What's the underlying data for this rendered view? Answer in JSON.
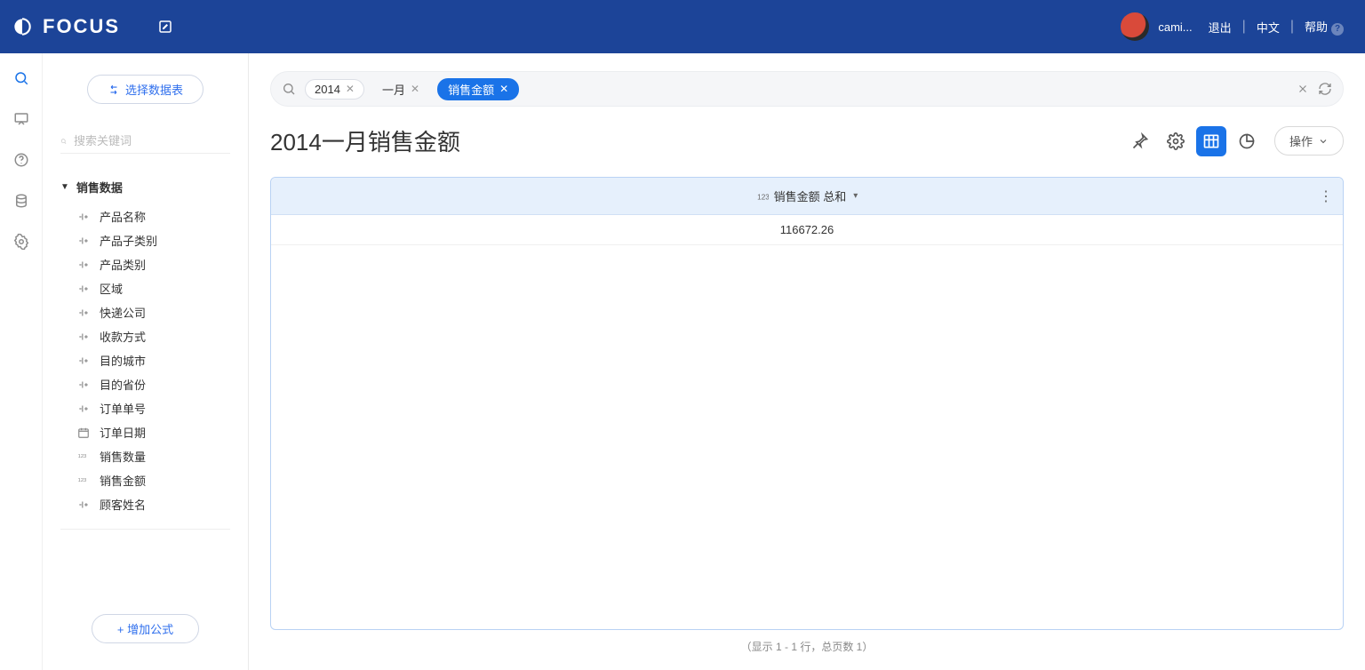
{
  "header": {
    "brand": "FOCUS",
    "user": "cami...",
    "logout": "退出",
    "lang": "中文",
    "help": "帮助"
  },
  "sidebar": {
    "select_table": "选择数据表",
    "search_placeholder": "搜索关键词",
    "group": "销售数据",
    "fields": [
      {
        "type": "text",
        "label": "产品名称"
      },
      {
        "type": "text",
        "label": "产品子类别"
      },
      {
        "type": "text",
        "label": "产品类别"
      },
      {
        "type": "text",
        "label": "区域"
      },
      {
        "type": "text",
        "label": "快递公司"
      },
      {
        "type": "text",
        "label": "收款方式"
      },
      {
        "type": "text",
        "label": "目的城市"
      },
      {
        "type": "text",
        "label": "目的省份"
      },
      {
        "type": "text",
        "label": "订单单号"
      },
      {
        "type": "date",
        "label": "订单日期"
      },
      {
        "type": "num",
        "label": "销售数量"
      },
      {
        "type": "num",
        "label": "销售金额"
      },
      {
        "type": "text",
        "label": "顾客姓名"
      }
    ],
    "add_formula": "增加公式"
  },
  "search": {
    "pill1": "2014",
    "pill2": "一月",
    "chip": "销售金额"
  },
  "page": {
    "title": "2014一月销售金额",
    "ops": "操作"
  },
  "table": {
    "column": "销售金额 总和",
    "value": "116672.26",
    "pager": "（显示 1 - 1 行，总页数 1）"
  }
}
